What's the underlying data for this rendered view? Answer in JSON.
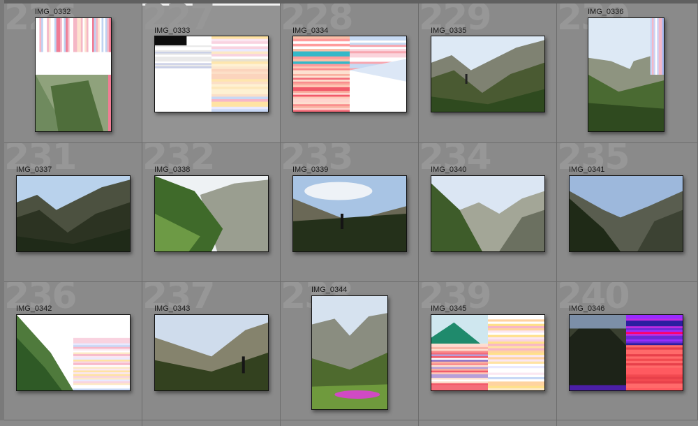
{
  "grid": {
    "cells": [
      {
        "index": "226",
        "name": "IMG_0332",
        "orient": "portrait",
        "style": "glitch-portrait-a"
      },
      {
        "index": "227",
        "name": "IMG_0333",
        "orient": "landscape",
        "style": "glitch-white",
        "selected": true
      },
      {
        "index": "228",
        "name": "IMG_0334",
        "orient": "landscape",
        "style": "glitch-red"
      },
      {
        "index": "229",
        "name": "IMG_0335",
        "orient": "landscape",
        "style": "mountain-hiker"
      },
      {
        "index": "230",
        "name": "IMG_0336",
        "orient": "portrait",
        "style": "mountain-portrait-glitch"
      },
      {
        "index": "231",
        "name": "IMG_0337",
        "orient": "landscape",
        "style": "mountain-dark"
      },
      {
        "index": "232",
        "name": "IMG_0338",
        "orient": "landscape",
        "style": "mountain-green"
      },
      {
        "index": "233",
        "name": "IMG_0339",
        "orient": "landscape",
        "style": "mountain-hiker-sky"
      },
      {
        "index": "234",
        "name": "IMG_0340",
        "orient": "landscape",
        "style": "mountain-valley"
      },
      {
        "index": "235",
        "name": "IMG_0341",
        "orient": "landscape",
        "style": "mountain-valley-dark"
      },
      {
        "index": "236",
        "name": "IMG_0342",
        "orient": "landscape",
        "style": "glitch-green-half"
      },
      {
        "index": "237",
        "name": "IMG_0343",
        "orient": "landscape",
        "style": "mountain-hiker-right"
      },
      {
        "index": "238",
        "name": "IMG_0344",
        "orient": "portrait",
        "style": "mountain-flowers"
      },
      {
        "index": "239",
        "name": "IMG_0345",
        "orient": "landscape",
        "style": "glitch-teal"
      },
      {
        "index": "240",
        "name": "IMG_0346",
        "orient": "landscape",
        "style": "glitch-magenta"
      }
    ]
  },
  "colors": {
    "cell_bg": "#8a8a8a",
    "cell_selected_bg": "#939393",
    "index_text": "#979797",
    "grid_line": "#6c6c6c"
  }
}
